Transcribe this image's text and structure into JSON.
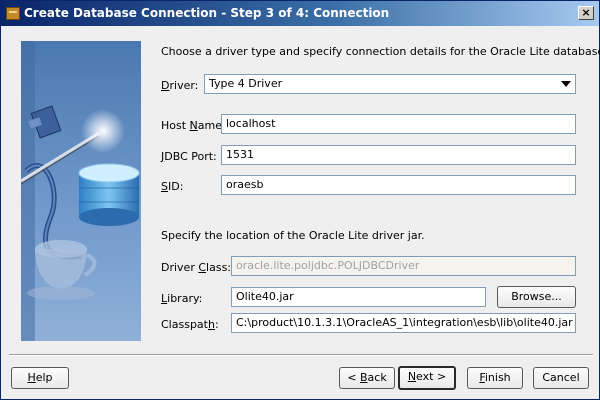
{
  "window": {
    "title": "Create Database Connection - Step 3 of 4: Connection",
    "close_label": "×"
  },
  "form": {
    "instructions": "Choose a driver type and specify connection details for the Oracle Lite database.",
    "driver": {
      "label_pre": "",
      "label_key": "D",
      "label_post": "river:",
      "value": "Type 4 Driver"
    },
    "host": {
      "label_pre": "Host ",
      "label_key": "N",
      "label_post": "ame:",
      "value": "localhost"
    },
    "port": {
      "label_pre": "",
      "label_key": "J",
      "label_post": "DBC Port:",
      "value": "1531"
    },
    "sid": {
      "label_pre": "",
      "label_key": "S",
      "label_post": "ID:",
      "value": "oraesb"
    },
    "jar_instructions": "Specify the location of the Oracle Lite driver jar.",
    "driver_class": {
      "label_pre": "Driver ",
      "label_key": "C",
      "label_post": "lass:",
      "value": "oracle.lite.poljdbc.POLJDBCDriver"
    },
    "library": {
      "label_pre": "",
      "label_key": "L",
      "label_post": "ibrary:",
      "value": "Olite40.jar"
    },
    "browse_button": "Browse...",
    "classpath": {
      "label_pre": "Classpat",
      "label_key": "h",
      "label_post": ":",
      "value": "C:\\product\\10.1.3.1\\OracleAS_1\\integration\\esb\\lib\\olite40.jar"
    }
  },
  "footer": {
    "help": {
      "pre": "",
      "key": "H",
      "post": "elp"
    },
    "back": {
      "pre": "< ",
      "key": "B",
      "post": "ack"
    },
    "next": {
      "pre": "",
      "key": "N",
      "post": "ext >"
    },
    "finish": {
      "pre": "",
      "key": "F",
      "post": "inish"
    },
    "cancel": "Cancel"
  },
  "icons": {
    "title_icon": "database-wizard-icon",
    "banner": "database-connection-illustration"
  }
}
